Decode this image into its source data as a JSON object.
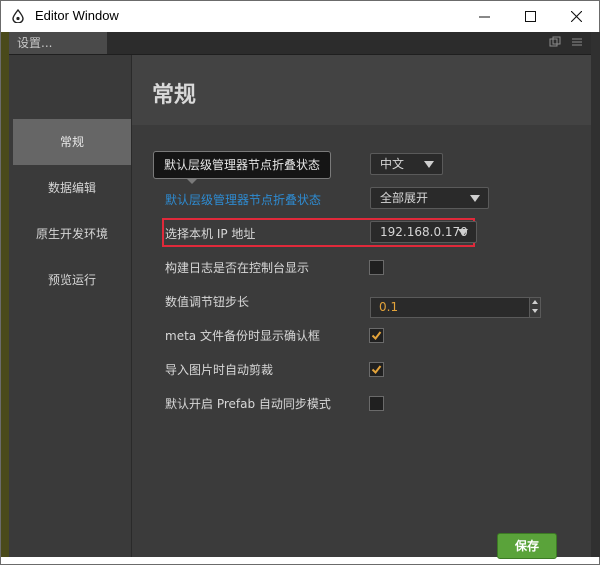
{
  "window": {
    "title": "Editor Window",
    "minimize": "minimize",
    "maximize": "maximize",
    "close": "close"
  },
  "tab": {
    "label": "设置..."
  },
  "sidebar": {
    "items": [
      {
        "label": "常规"
      },
      {
        "label": "数据编辑"
      },
      {
        "label": "原生开发环境"
      },
      {
        "label": "预览运行"
      }
    ]
  },
  "main": {
    "heading": "常规",
    "tooltip": "默认层级管理器节点折叠状态",
    "rows": {
      "language_value": "中文",
      "hierarchy_fold_label": "默认层级管理器节点折叠状态",
      "hierarchy_fold_value": "全部展开",
      "ip_label": "选择本机 IP 地址",
      "ip_value": "192.168.0.170",
      "build_log_label": "构建日志是否在控制台显示",
      "build_log_checked": false,
      "step_label": "数值调节钮步长",
      "step_value": "0.1",
      "meta_backup_label": "meta 文件备份时显示确认框",
      "meta_backup_checked": true,
      "auto_crop_label": "导入图片时自动剪裁",
      "auto_crop_checked": true,
      "prefab_sync_label": "默认开启 Prefab 自动同步模式",
      "prefab_sync_checked": false
    },
    "save_label": "保存"
  },
  "colors": {
    "accent_link": "#2e8bd1",
    "highlight": "#e0293a",
    "checkmark": "#e3a33a",
    "save_button": "#5aa33a"
  }
}
